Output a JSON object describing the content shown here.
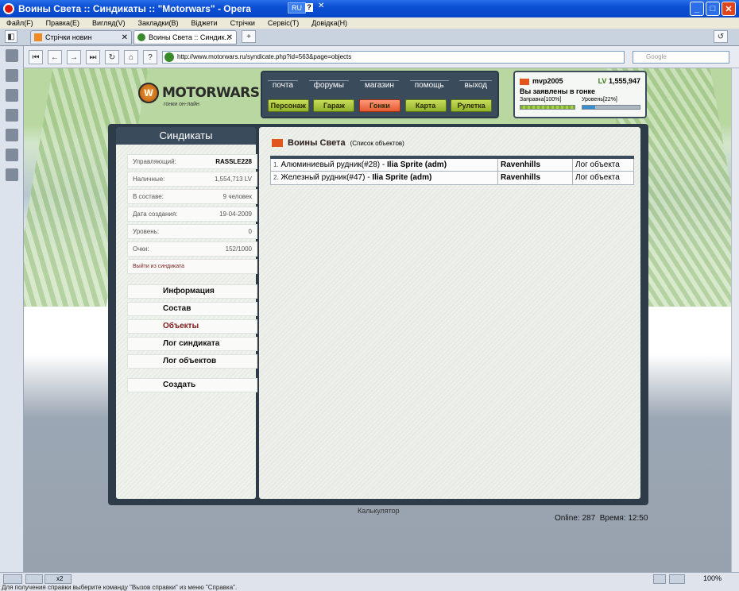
{
  "window": {
    "title": "Воины Света :: Синдикаты :: \"Motorwars\" - Opera",
    "lang": "RU",
    "lang_help": "?",
    "lang_close": "✕"
  },
  "menu": [
    "Файл(F)",
    "Правка(E)",
    "Вигляд(V)",
    "Закладки(B)",
    "Віджети",
    "Стрічки",
    "Сервіс(T)",
    "Довідка(H)"
  ],
  "tabs": [
    {
      "label": "Стрічки новин",
      "close": "✕"
    },
    {
      "label": "Воины Света :: Синдик...",
      "close": "✕"
    }
  ],
  "tab_new": "+",
  "nav": {
    "url": "http://www.motorwars.ru/syndicate.php?id=563&page=objects",
    "search_placeholder": "Google",
    "back": "←",
    "forward": "→",
    "reload": "↻",
    "home": "⌂"
  },
  "site": {
    "logo_letter": "W",
    "logo_text": "MOTORWARS.RU",
    "logo_sub": "гонки он-лайн",
    "nav_links": [
      "почта",
      "форумы",
      "магазин",
      "помощь",
      "выход"
    ],
    "nav_buttons": [
      "Персонаж",
      "Гараж",
      "Гонки",
      "Карта",
      "Рулетка"
    ]
  },
  "user": {
    "name": "mvp2005",
    "lv_label": "LV",
    "lv_value": "1,555,947",
    "status": "Вы заявлены в гонке",
    "fuel_label": "Заправка[100%]",
    "level_label": "Уровень[22%]",
    "fuel_pct": 1.0,
    "level_pct": 0.22
  },
  "syndicate": {
    "header": "Синдикаты",
    "info": [
      {
        "label": "Управляющий:",
        "value": "RASSLE228"
      },
      {
        "label": "Наличные:",
        "value": "1,554,713 LV"
      },
      {
        "label": "В составе:",
        "value": "9 человек"
      },
      {
        "label": "Дата создания:",
        "value": "19-04-2009"
      },
      {
        "label": "Уровень:",
        "value": "0"
      },
      {
        "label": "Очки:",
        "value": "152/1000"
      }
    ],
    "leave": "Выйти из синдиката",
    "menu": [
      "Информация",
      "Состав",
      "Объекты",
      "Лог синдиката",
      "Лог объектов",
      "Создать"
    ]
  },
  "content": {
    "title": "Воины Света",
    "subtitle": "(Список объектов)",
    "rows": [
      {
        "num": "1.",
        "name": "Алюминиевый рудник(#28)",
        "sep": " - ",
        "owner": "Ilia Sprite (adm)",
        "location": "Ravenhills",
        "log": "Лог объекта"
      },
      {
        "num": "2.",
        "name": "Железный рудник(#47)",
        "sep": " - ",
        "owner": "Ilia Sprite (adm)",
        "location": "Ravenhills",
        "log": "Лог объекта"
      }
    ]
  },
  "footer": {
    "calc": "Калькулятор",
    "online_label": "Online:",
    "online_value": "287",
    "time_label": "Время:",
    "time_value": "12:50"
  },
  "status": {
    "hint": "Для получения справки выберите команду \"Вызов справки\" из меню \"Справка\".",
    "zoom": "100%",
    "badge": "x2"
  }
}
